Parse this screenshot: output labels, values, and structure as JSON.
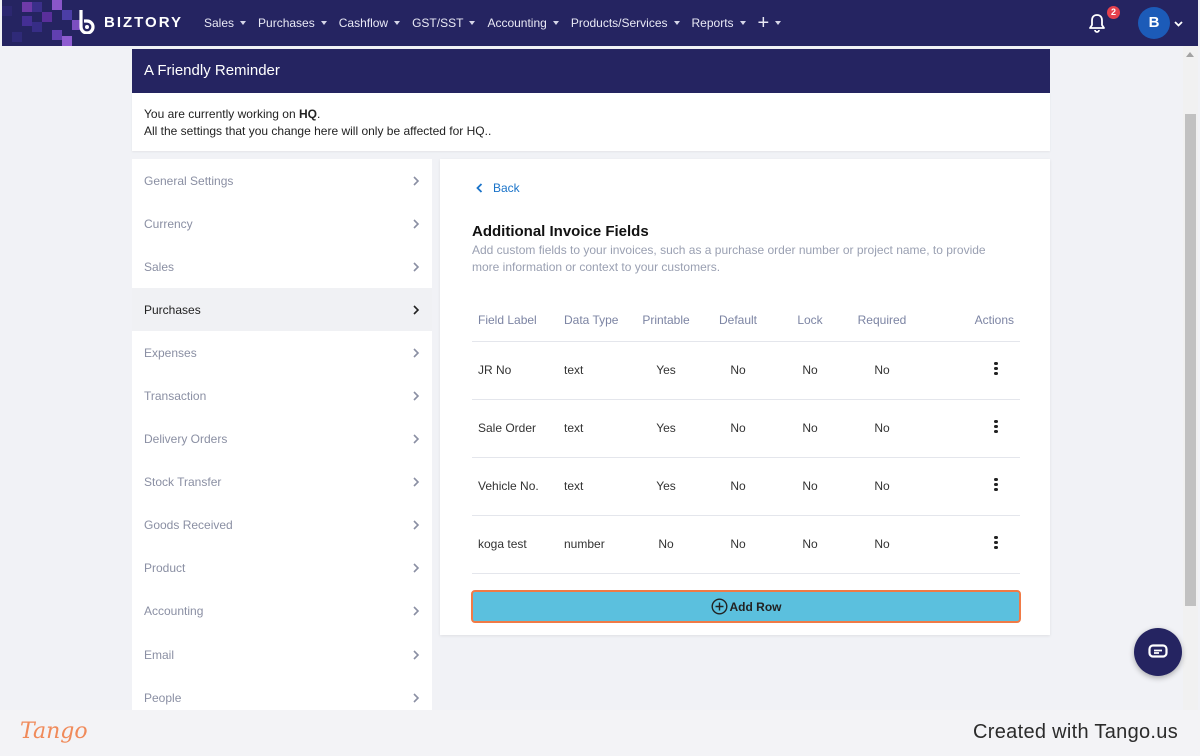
{
  "nav": {
    "brand": "BIZTORY",
    "menu": [
      "Sales",
      "Purchases",
      "Cashflow",
      "GST/SST",
      "Accounting",
      "Products/Services",
      "Reports"
    ],
    "plus": "+",
    "notification_count": "2",
    "avatar_initial": "B"
  },
  "reminder": {
    "title": "A Friendly Reminder",
    "line1_prefix": "You are currently working on ",
    "line1_bold": "HQ",
    "line1_suffix": ".",
    "line2": "All the settings that you change here will only be affected for HQ.."
  },
  "sidebar": {
    "items": [
      "General Settings",
      "Currency",
      "Sales",
      "Purchases",
      "Expenses",
      "Transaction",
      "Delivery Orders",
      "Stock Transfer",
      "Goods Received",
      "Product",
      "Accounting",
      "Email",
      "People"
    ],
    "active": "Purchases"
  },
  "main": {
    "back_label": "Back",
    "title": "Additional Invoice Fields",
    "description": "Add custom fields to your invoices, such as a purchase order number or project name, to provide more information or context to your customers.",
    "columns": [
      "Field Label",
      "Data Type",
      "Printable",
      "Default",
      "Lock",
      "Required",
      "Actions"
    ],
    "rows": [
      [
        "JR No",
        "text",
        "Yes",
        "No",
        "No",
        "No"
      ],
      [
        "Sale Order",
        "text",
        "Yes",
        "No",
        "No",
        "No"
      ],
      [
        "Vehicle No.",
        "text",
        "Yes",
        "No",
        "No",
        "No"
      ],
      [
        "koga test",
        "number",
        "No",
        "No",
        "No",
        "No"
      ]
    ],
    "add_row_label": "Add Row"
  },
  "footer": {
    "logo": "Tango",
    "created": "Created with Tango.us"
  },
  "colors": {
    "nav_bg": "#252461",
    "accent_link": "#1a73c9",
    "add_row_bg": "#5bc0de",
    "highlight_border": "#f07a46"
  }
}
